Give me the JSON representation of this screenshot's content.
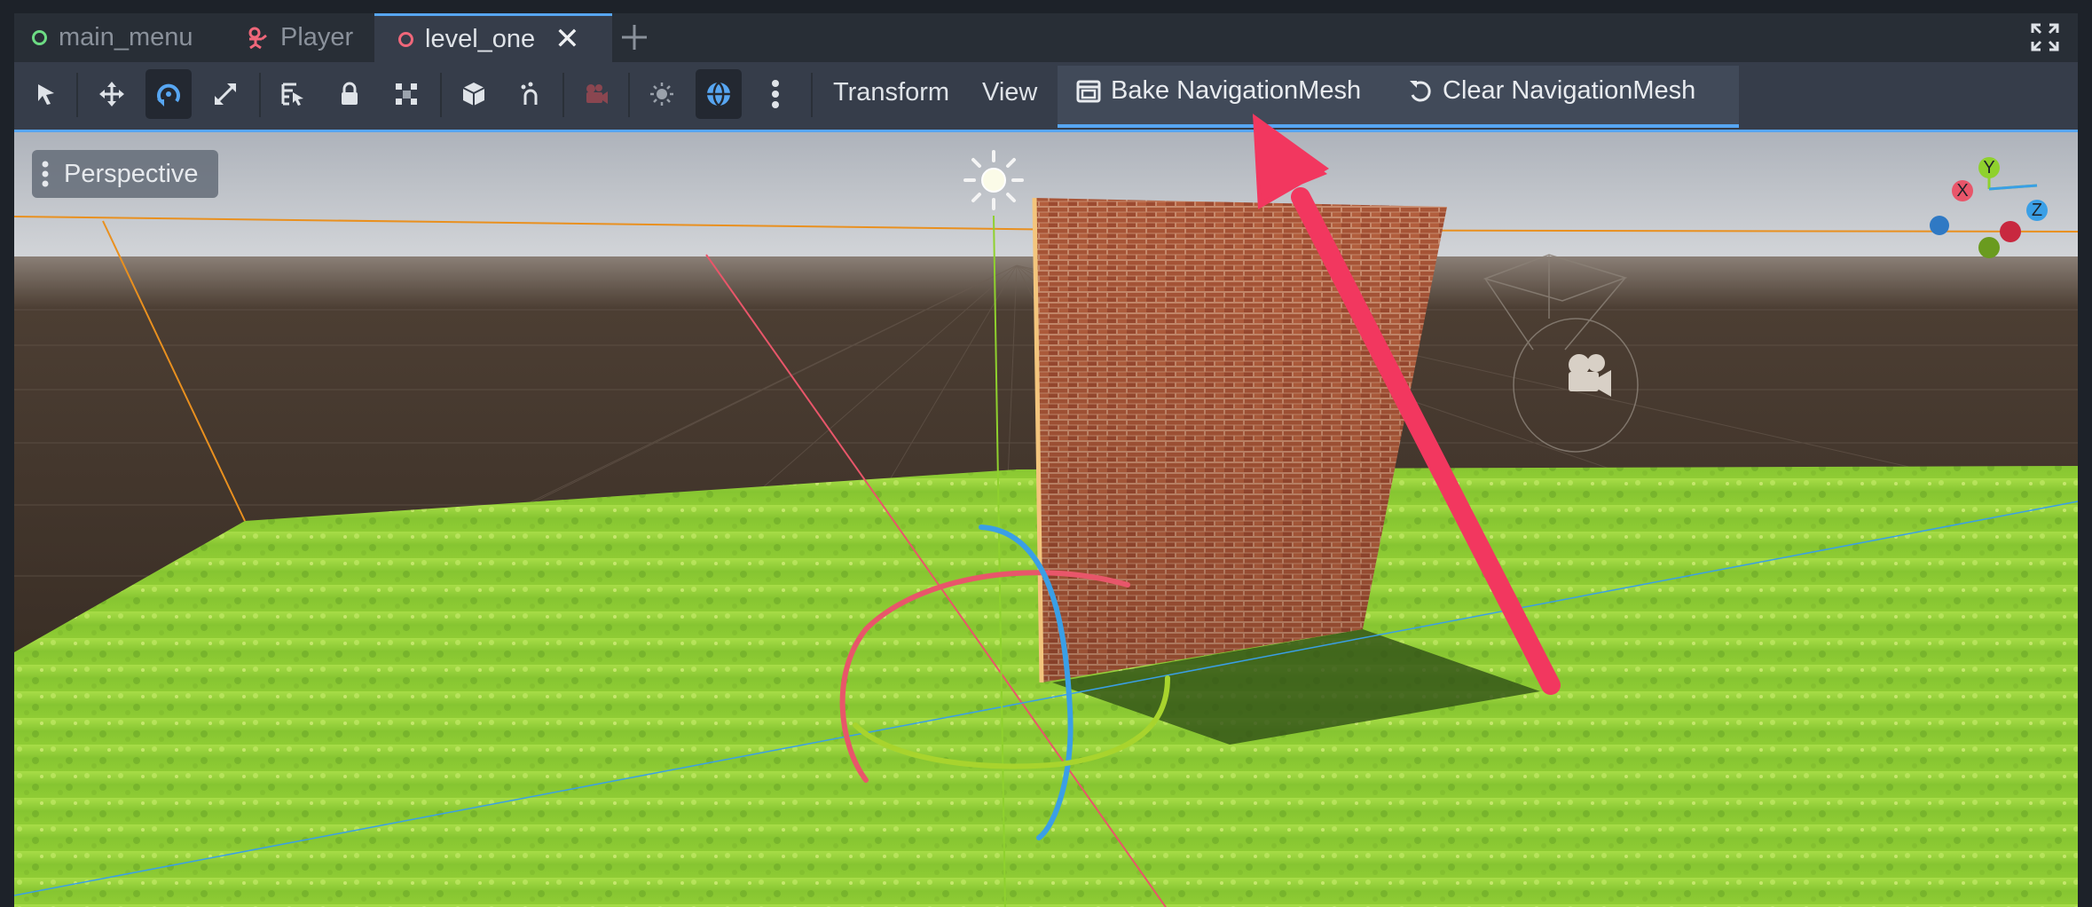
{
  "tabs": [
    {
      "label": "main_menu",
      "icon": "scene-root-icon",
      "color": "#6ddc84"
    },
    {
      "label": "Player",
      "icon": "character-body-icon",
      "color": "#f0677a"
    },
    {
      "label": "level_one",
      "icon": "scene-root-icon",
      "color": "#f0677a",
      "active": true
    }
  ],
  "toolbar": {
    "menus": {
      "transform": "Transform",
      "view": "View"
    },
    "navigation": {
      "bake_label": "Bake NavigationMesh",
      "clear_label": "Clear NavigationMesh"
    },
    "tools": [
      "select-icon",
      "move-icon",
      "rotate-icon",
      "scale-icon",
      "list-select-icon",
      "lock-icon",
      "group-icon",
      "local-space-icon",
      "snap-icon",
      "camera-preview-icon",
      "sun-preview-icon",
      "environment-preview-icon",
      "more-options-icon"
    ]
  },
  "viewport": {
    "view_menu_label": "Perspective",
    "gizmo_axes": {
      "x": "X",
      "y": "Y",
      "z": "Z"
    }
  },
  "colors": {
    "accent": "#57a6f2",
    "axis_x": "#e8566a",
    "axis_y": "#8fd12e",
    "axis_z": "#3a9fe6",
    "arrow_annotation": "#f2375f"
  }
}
